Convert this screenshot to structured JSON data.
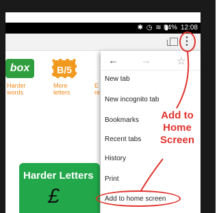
{
  "status_bar": {
    "icons": "✱ ◷ ≋ ▮",
    "battery": "84%",
    "time": "12:08"
  },
  "toolbar": {
    "menu_glyph": "⋮"
  },
  "page": {
    "tiles": [
      {
        "text": "box",
        "label": [
          "Harder",
          "words"
        ]
      },
      {
        "text": "B/5",
        "label": [
          "More",
          "letters"
        ]
      },
      {
        "text": "",
        "label": [
          "E",
          "re"
        ]
      }
    ],
    "card_title": "Harder Letters",
    "card_glyph": "£"
  },
  "menu": {
    "nav": {
      "back": "←",
      "forward": "→",
      "star": "☆"
    },
    "items": [
      "New tab",
      "New incognito tab",
      "Bookmarks",
      "Recent tabs",
      "History",
      "Print",
      "Add to home screen"
    ]
  },
  "annotation": {
    "lines": [
      "Add to",
      "Home",
      "Screen"
    ],
    "color": "#e0322c"
  }
}
